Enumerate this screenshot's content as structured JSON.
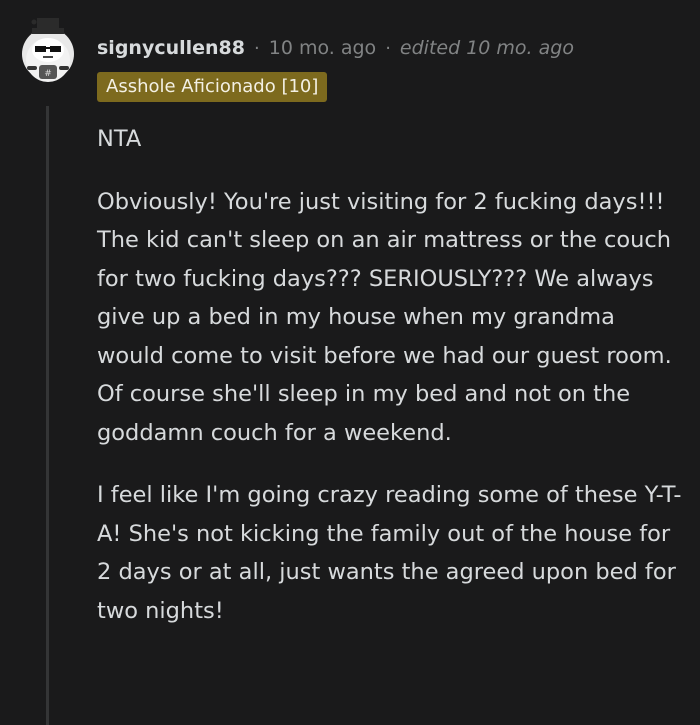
{
  "comment": {
    "author": "signycullen88",
    "separator": "·",
    "timestamp": "10 mo. ago",
    "edited": "edited 10 mo. ago",
    "flair": "Asshole Aficionado [10]",
    "flair_color": "#7d6a1e",
    "avatar_icon": "snoo-avatar-icon",
    "paragraphs": [
      "NTA",
      "Obviously! You're just visiting for 2 fucking days!!! The kid can't sleep on an air mattress or the couch for two fucking days??? SERIOUSLY??? We always give up a bed in my house when my grandma would come to visit before we had our guest room. Of course she'll sleep in my bed and not on the goddamn couch for a weekend.",
      "I feel like I'm going crazy reading some of these Y-T-A! She's not kicking the family out of the house for 2 days or at all, just wants the agreed upon bed for two nights!"
    ]
  }
}
